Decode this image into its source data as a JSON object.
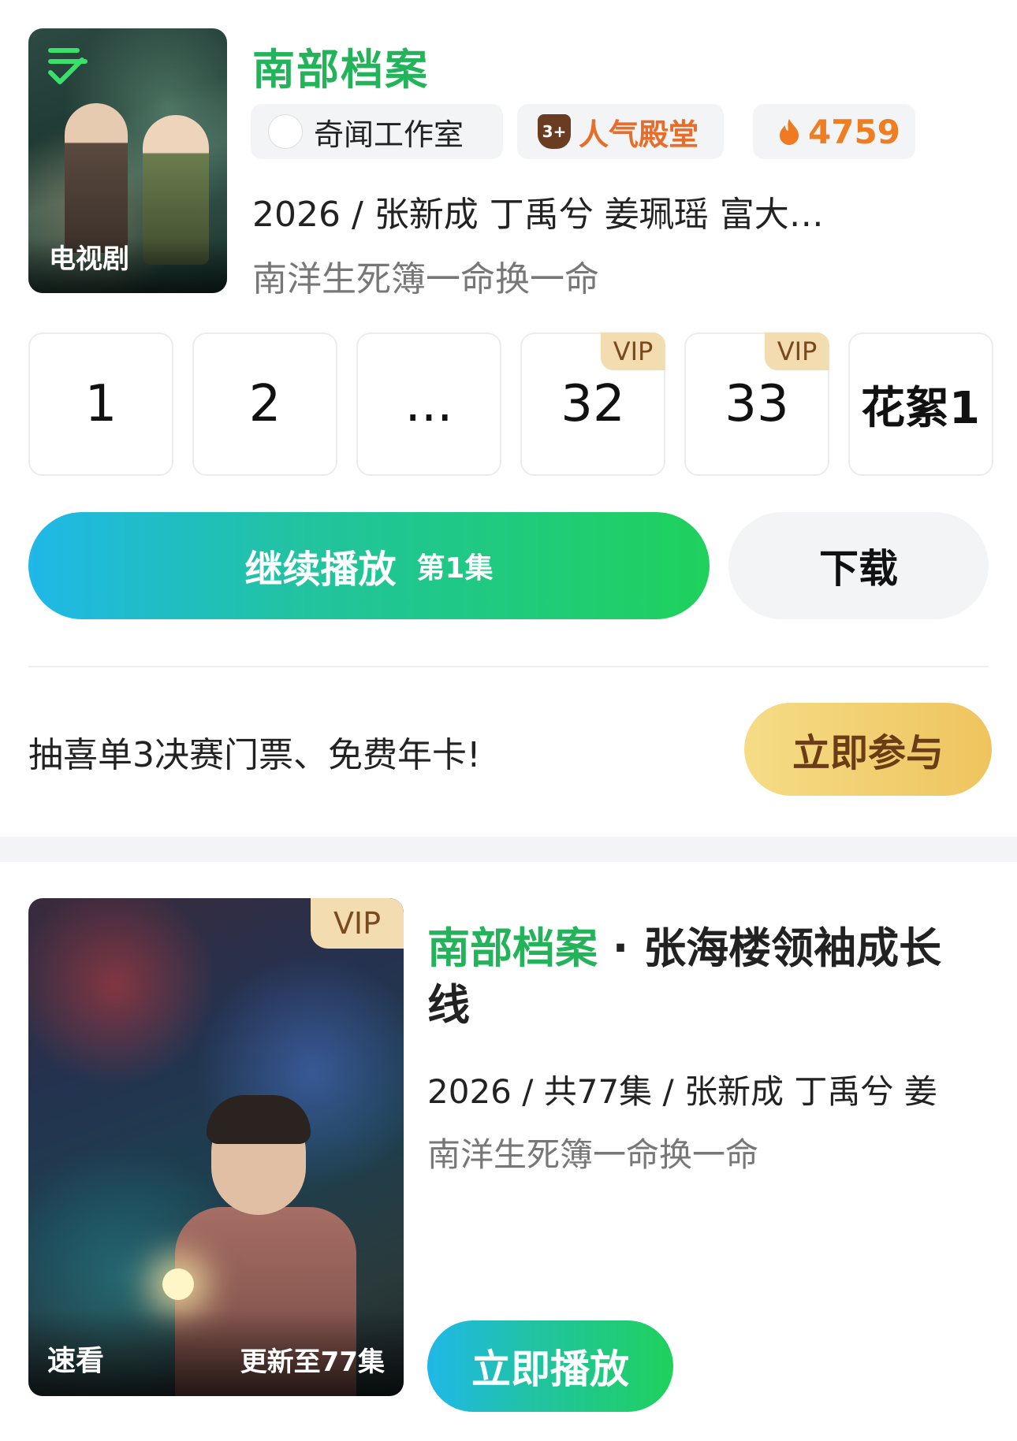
{
  "card1": {
    "poster_badge": "电视剧",
    "title": "南部档案",
    "tags": {
      "studio": "奇闻工作室",
      "rank": "人气殿堂",
      "rank_icon_text": "3+",
      "heat": "4759"
    },
    "meta": "2026 / 张新成  丁禹兮  姜珮瑶  富大…",
    "description": "南洋生死簿一命换一命",
    "episodes": [
      {
        "label": "1",
        "vip": ""
      },
      {
        "label": "2",
        "vip": ""
      },
      {
        "label": "...",
        "vip": ""
      },
      {
        "label": "32",
        "vip": "VIP"
      },
      {
        "label": "33",
        "vip": "VIP"
      },
      {
        "label": "花絮1",
        "vip": ""
      }
    ],
    "play_button": {
      "label": "继续播放",
      "episode": "第1集"
    },
    "download_button": "下载"
  },
  "promo": {
    "text": "抽喜单3决赛门票、免费年卡!",
    "button": "立即参与"
  },
  "card2": {
    "vip": "VIP",
    "fast_label": "速看",
    "update_label": "更新至77集",
    "title_show": "南部档案",
    "title_rest": " · 张海楼领袖成长线",
    "meta": "2026 / 共77集 / 张新成 丁禹兮 姜",
    "description": "南洋生死簿一命换一命",
    "play_button": "立即播放"
  },
  "colors": {
    "brand_green": "#23b35a",
    "play_gradient_start": "#1fb8e8",
    "play_gradient_end": "#1fd15c",
    "vip_bg": "#f3dcb0",
    "heat_orange": "#ef7d22",
    "join_gold": "#efc45e"
  },
  "icons": [
    "check-list-icon",
    "studio-logo-icon",
    "rank-shield-icon",
    "flame-icon"
  ]
}
